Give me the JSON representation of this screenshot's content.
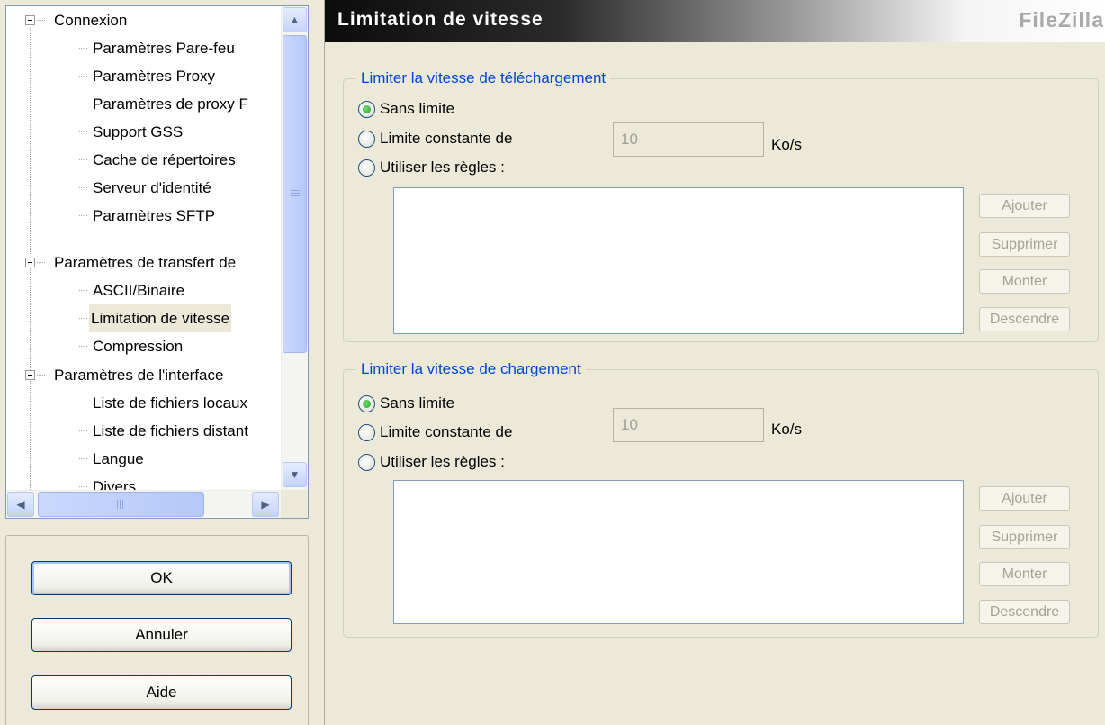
{
  "tree": {
    "items": [
      {
        "label": "Connexion",
        "expandable": true
      },
      {
        "label": "Paramètres Pare-feu"
      },
      {
        "label": "Paramètres Proxy"
      },
      {
        "label": "Paramètres de proxy F"
      },
      {
        "label": "Support GSS"
      },
      {
        "label": "Cache de répertoires"
      },
      {
        "label": "Serveur d'identité"
      },
      {
        "label": "Paramètres SFTP"
      },
      {
        "label": "Paramètres de transfert de",
        "expandable": true
      },
      {
        "label": "ASCII/Binaire"
      },
      {
        "label": "Limitation de vitesse",
        "selected": true
      },
      {
        "label": "Compression"
      },
      {
        "label": "Paramètres de l'interface",
        "expandable": true
      },
      {
        "label": "Liste de fichiers locaux"
      },
      {
        "label": "Liste de fichiers distant"
      },
      {
        "label": "Langue"
      },
      {
        "label": "Divers"
      }
    ]
  },
  "buttons": {
    "ok": "OK",
    "cancel": "Annuler",
    "help": "Aide"
  },
  "panel": {
    "title": "Limitation de vitesse",
    "brand": "FileZilla"
  },
  "download": {
    "legend": "Limiter la vitesse de téléchargement",
    "no_limit": "Sans limite",
    "constant_limit": "Limite constante de",
    "use_rules": "Utiliser les règles :",
    "value": "10",
    "unit": "Ko/s",
    "selected": "no_limit",
    "add": "Ajouter",
    "remove": "Supprimer",
    "up": "Monter",
    "down": "Descendre"
  },
  "upload": {
    "legend": "Limiter la vitesse de chargement",
    "no_limit": "Sans limite",
    "constant_limit": "Limite constante de",
    "use_rules": "Utiliser les règles :",
    "value": "10",
    "unit": "Ko/s",
    "selected": "no_limit",
    "add": "Ajouter",
    "remove": "Supprimer",
    "up": "Monter",
    "down": "Descendre"
  }
}
